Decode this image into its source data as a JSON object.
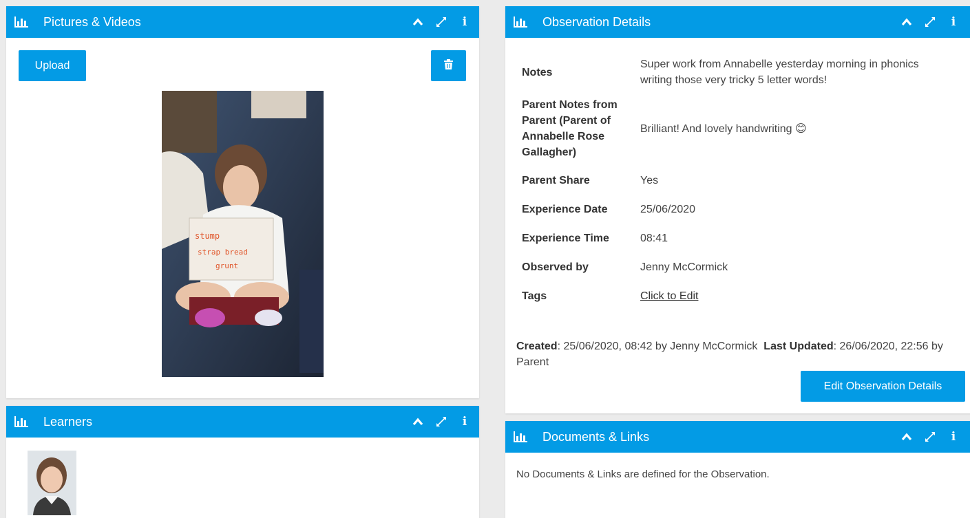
{
  "panels": {
    "pictures": {
      "title": "Pictures & Videos",
      "upload_label": "Upload"
    },
    "learners": {
      "title": "Learners"
    },
    "observation": {
      "title": "Observation Details",
      "rows": [
        {
          "label": "Notes",
          "value": "Super work from Annabelle yesterday morning in phonics writing those very tricky 5 letter words!"
        },
        {
          "label": "Parent Notes from Parent (Parent of Annabelle Rose Gallagher)",
          "value": "Brilliant! And lovely handwriting 😊"
        },
        {
          "label": "Parent Share",
          "value": "Yes"
        },
        {
          "label": "Experience Date",
          "value": "25/06/2020"
        },
        {
          "label": "Experience Time",
          "value": "08:41"
        },
        {
          "label": "Observed by",
          "value": "Jenny McCormick"
        },
        {
          "label": "Tags",
          "value": "Click to Edit"
        }
      ],
      "created_label": "Created",
      "created_value": ": 25/06/2020, 08:42 by Jenny McCormick",
      "updated_label": "Last Updated",
      "updated_value": ": 26/06/2020, 22:56 by Parent",
      "edit_label": "Edit Observation Details"
    },
    "documents": {
      "title": "Documents & Links",
      "empty_text": "No Documents & Links are defined for the Observation."
    }
  },
  "icons": {
    "panel": "bar-chart-icon",
    "collapse": "chevron-up-icon",
    "expand": "expand-icon",
    "info": "info-icon",
    "delete": "trash-icon"
  },
  "colors": {
    "header": "#039be5",
    "button": "#039be5",
    "background": "#ebebeb"
  }
}
